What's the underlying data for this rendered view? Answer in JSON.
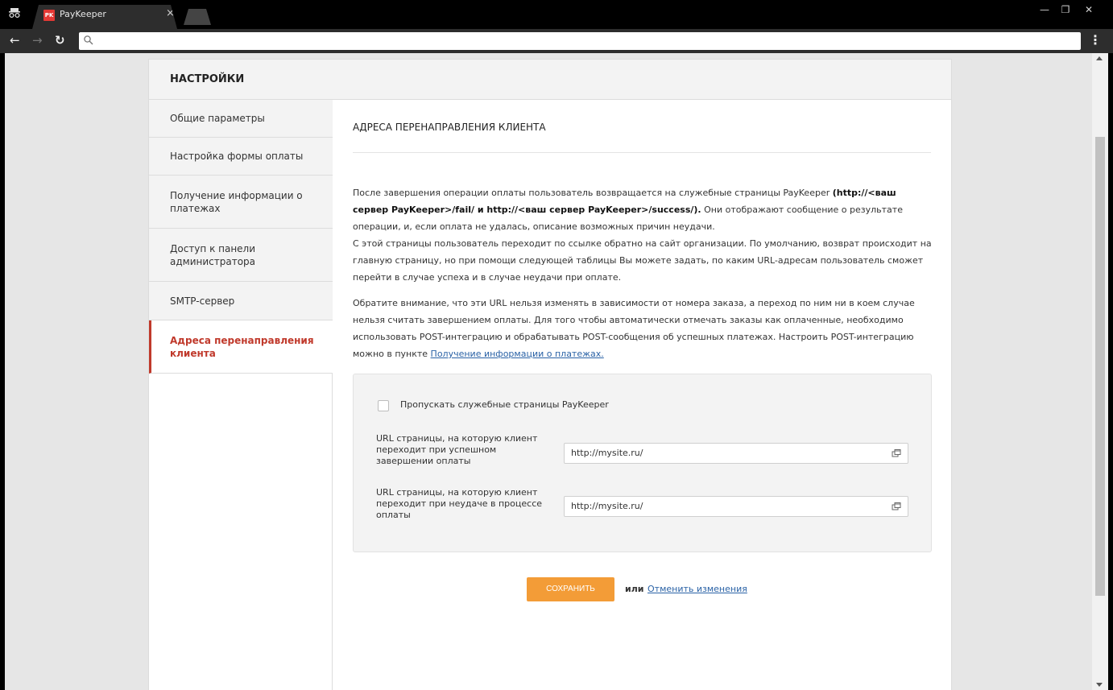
{
  "browser": {
    "tab_title": "PayKeeper",
    "tab_favicon_text": "PK",
    "tab_close": "×",
    "address_value": "",
    "icons": [
      "incognito-icon",
      "back-icon",
      "forward-icon",
      "reload-icon",
      "search-icon",
      "menu-icon"
    ]
  },
  "page": {
    "title": "НАСТРОЙКИ",
    "sidebar": {
      "items": [
        {
          "label": "Общие параметры",
          "active": false
        },
        {
          "label": "Настройка формы оплаты",
          "active": false
        },
        {
          "label": "Получение информации о платежах",
          "active": false
        },
        {
          "label": "Доступ к панели администратора",
          "active": false
        },
        {
          "label": "SMTP-сервер",
          "active": false
        },
        {
          "label": "Адреса перенаправления клиента",
          "active": true
        }
      ],
      "active_color": "#c0392b"
    },
    "content": {
      "title": "АДРЕСА ПЕРЕНАПРАВЛЕНИЯ КЛИЕНТА",
      "p1_text_a": "После завершения операции оплаты пользователь возвращается на служебные страницы PayKeeper ",
      "p1_bold": "(http://<ваш сервер PayKeeper>/fail/ и http://<ваш сервер PayKeeper>/success/).",
      "p1_text_b": " Они отображают сообщение о результате операции, и, если оплата не удалась, описание возможных причин неудачи.",
      "p2": "С этой страницы пользователь переходит по ссылке обратно на сайт организации. По умолчанию, возврат происходит на главную страницу, но при помощи следующей таблицы Вы можете задать, по каким URL-адресам пользователь сможет перейти в случае успеха и в случае неудачи при оплате.",
      "p3_text": "Обратите внимание, что эти URL нельзя изменять в зависимости от номера заказа, а переход по ним ни в коем случае нельзя считать завершением оплаты. Для того чтобы автоматически отмечать заказы как оплаченные, необходимо использовать POST-интеграцию и обрабатывать POST-сообщения об успешных платежах. Настроить POST-интеграцию можно в пункте ",
      "p3_link": "Получение информации о платежах."
    },
    "form": {
      "skip_checkbox_label": "Пропускать служебные страницы PayKeeper",
      "skip_checked": false,
      "success_label": "URL страницы, на которую клиент переходит при успешном завершении оплаты",
      "success_value": "http://mysite.ru/",
      "fail_label": "URL страницы, на которую клиент переходит при неудаче в процессе оплаты",
      "fail_value": "http://mysite.ru/"
    },
    "actions": {
      "save_label": "СОХРАНИТЬ",
      "or_text": "или",
      "cancel_label": "Отменить изменения",
      "save_color": "#f39c37"
    }
  }
}
